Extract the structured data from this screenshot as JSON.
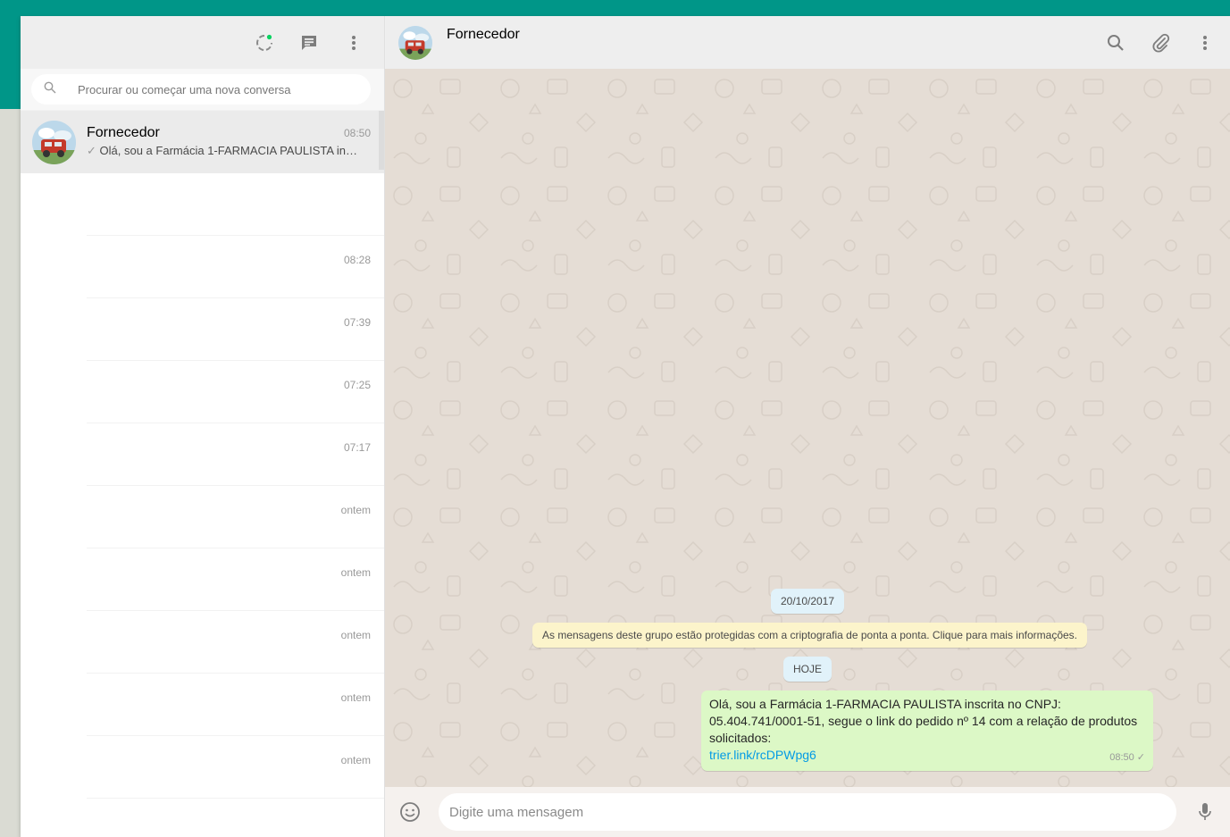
{
  "colors": {
    "brand_band": "#009688",
    "out_bubble": "#dcf8c6",
    "system_bubble": "#fcf4cb",
    "day_pill": "#e1f2fa",
    "link": "#039be5"
  },
  "left_header": {
    "icons": [
      "status-icon",
      "new-chat-icon",
      "menu-icon"
    ]
  },
  "search": {
    "placeholder": "Procurar ou começar uma nova conversa"
  },
  "chats": [
    {
      "name": "Fornecedor",
      "time": "08:50",
      "preview": "Olá, sou a Farmácia 1-FARMACIA PAULISTA ins...",
      "active": true
    },
    {
      "name": "",
      "time": "",
      "preview": ""
    },
    {
      "name": "",
      "time": "08:28",
      "preview": ""
    },
    {
      "name": "",
      "time": "07:39",
      "preview": ""
    },
    {
      "name": "",
      "time": "07:25",
      "preview": ""
    },
    {
      "name": "",
      "time": "07:17",
      "preview": ""
    },
    {
      "name": "",
      "time": "ontem",
      "preview": ""
    },
    {
      "name": "",
      "time": "ontem",
      "preview": ""
    },
    {
      "name": "",
      "time": "ontem",
      "preview": ""
    },
    {
      "name": "",
      "time": "ontem",
      "preview": ""
    },
    {
      "name": "",
      "time": "ontem",
      "preview": ""
    }
  ],
  "conversation": {
    "contact_name": "Fornecedor",
    "header_icons": [
      "search-icon",
      "attach-icon",
      "menu-icon"
    ],
    "date_pill": "20/10/2017",
    "system_message": "As mensagens deste grupo estão protegidas com a criptografia de ponta a ponta. Clique para mais informações.",
    "today_pill": "HOJE",
    "outgoing": {
      "text": "Olá, sou a Farmácia 1-FARMACIA PAULISTA inscrita no CNPJ: 05.404.741/0001-51, segue o link do pedido nº 14 com a relação de produtos solicitados:",
      "link": "trier.link/rcDPWpg6",
      "time": "08:50"
    }
  },
  "composer": {
    "placeholder": "Digite uma mensagem"
  }
}
